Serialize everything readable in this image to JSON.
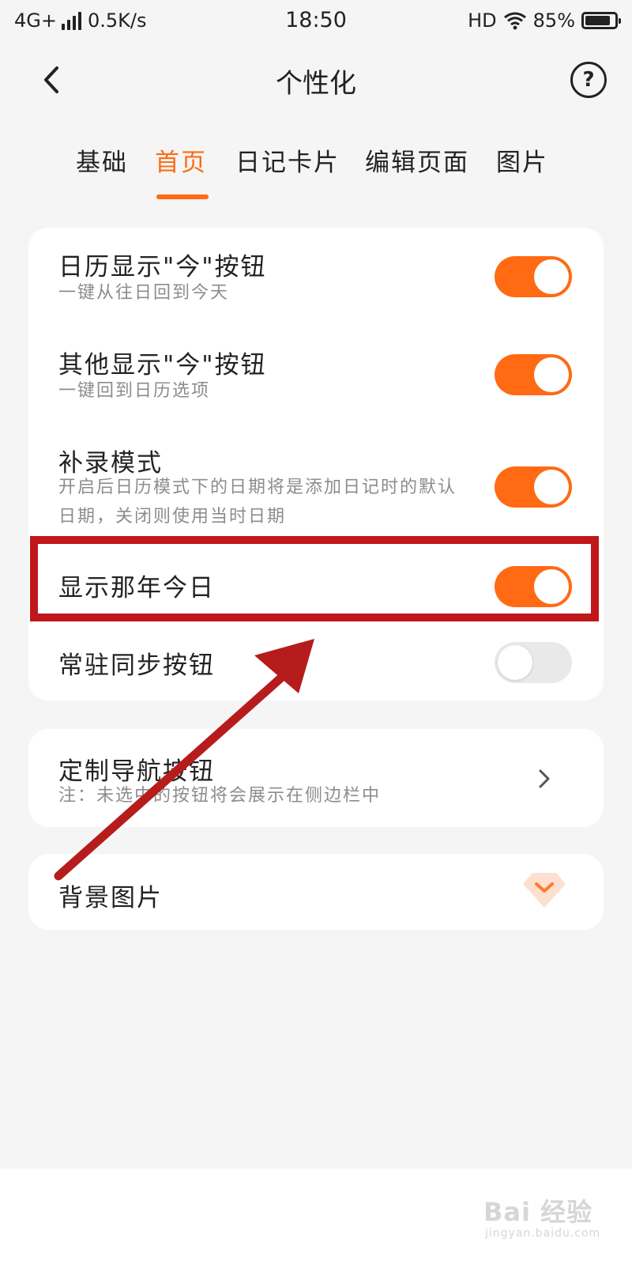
{
  "status_bar": {
    "network": "4G+",
    "speed": "0.5K/s",
    "time": "18:50",
    "hd": "HD",
    "battery_percent": "85%",
    "battery_level": 0.85
  },
  "header": {
    "title": "个性化",
    "help_label": "?"
  },
  "tabs": [
    {
      "label": "基础",
      "active": false
    },
    {
      "label": "首页",
      "active": true
    },
    {
      "label": "日记卡片",
      "active": false
    },
    {
      "label": "编辑页面",
      "active": false
    },
    {
      "label": "图片",
      "active": false
    }
  ],
  "settings": [
    {
      "title": "日历显示\"今\"按钮",
      "subtitle": "一键从往日回到今天",
      "enabled": true
    },
    {
      "title": "其他显示\"今\"按钮",
      "subtitle": "一键回到日历选项",
      "enabled": true
    },
    {
      "title": "补录模式",
      "subtitle": "开启后日历模式下的日期将是添加日记时的默认日期，关闭则使用当时日期",
      "enabled": true
    },
    {
      "title": "显示那年今日",
      "subtitle": "",
      "enabled": true
    },
    {
      "title": "常驻同步按钮",
      "subtitle": "",
      "enabled": false
    }
  ],
  "nav_custom": {
    "title": "定制导航按钮",
    "note": "注：未选中的按钮将会展示在侧边栏中"
  },
  "background_image": {
    "title": "背景图片"
  },
  "colors": {
    "accent": "#ff6a13",
    "annotation": "#c0171b",
    "background": "#f5f5f5"
  },
  "watermark": {
    "text": "Bai 经验",
    "sub": "jingyan.baidu.com"
  }
}
